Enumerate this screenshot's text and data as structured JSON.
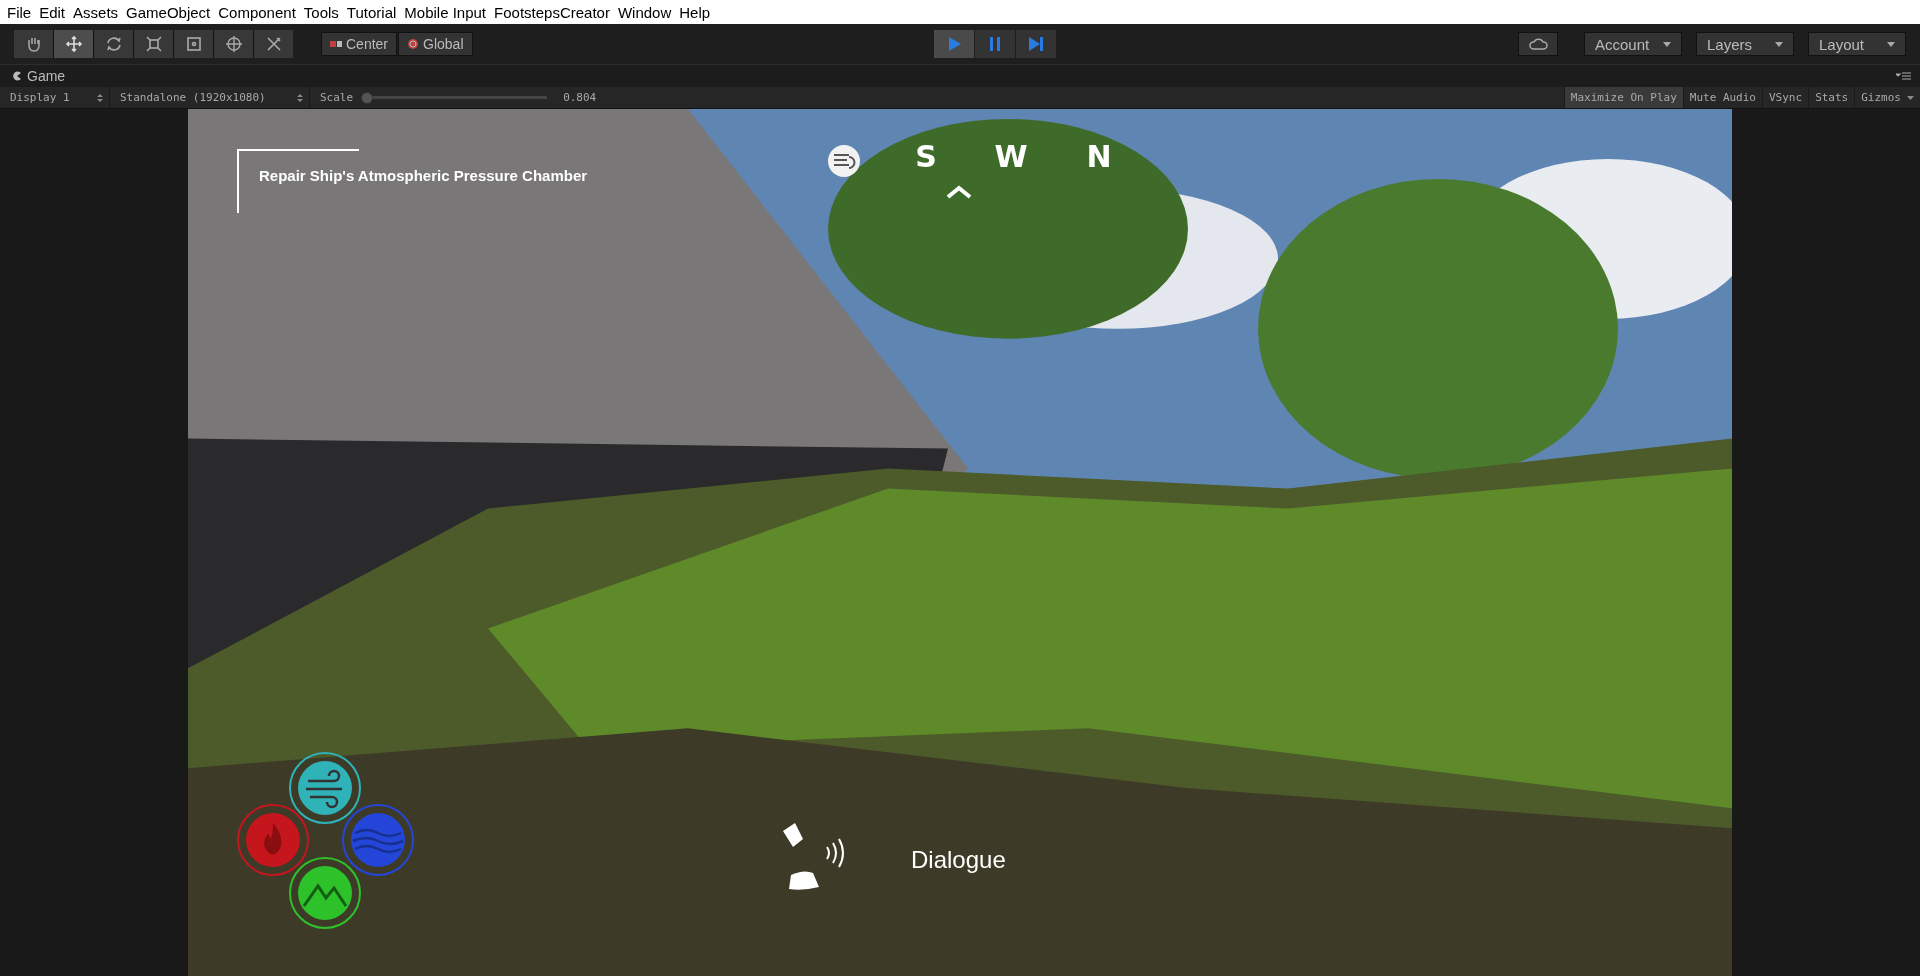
{
  "menu": [
    "File",
    "Edit",
    "Assets",
    "GameObject",
    "Component",
    "Tools",
    "Tutorial",
    "Mobile Input",
    "FootstepsCreator",
    "Window",
    "Help"
  ],
  "toolbar": {
    "tools": [
      {
        "kind": "hand",
        "selected": false
      },
      {
        "kind": "move",
        "selected": true
      },
      {
        "kind": "rotate",
        "selected": false
      },
      {
        "kind": "scale",
        "selected": false
      },
      {
        "kind": "rect",
        "selected": false
      },
      {
        "kind": "transform",
        "selected": false
      },
      {
        "kind": "custom",
        "selected": false
      }
    ],
    "pivot": [
      "Center",
      "Global"
    ],
    "playback": [
      {
        "kind": "play",
        "selected": true
      },
      {
        "kind": "pause",
        "selected": false
      },
      {
        "kind": "step",
        "selected": false
      }
    ],
    "dropdowns": [
      "Account",
      "Layers",
      "Layout"
    ]
  },
  "game_tab": {
    "title": "Game"
  },
  "game_bar": {
    "display": "Display 1",
    "resolution": "Standalone (1920x1080)",
    "scale": {
      "label": "Scale",
      "level": 0,
      "reading": "0.804"
    },
    "toggles": [
      {
        "label": "Maximize On Play",
        "on": true
      },
      {
        "label": "Mute Audio",
        "on": false
      },
      {
        "label": "VSync",
        "on": false
      },
      {
        "label": "Stats",
        "on": false
      }
    ],
    "gizmos": "Gizmos"
  },
  "hud": {
    "objective": "Repair Ship's Atmospheric Pressure Chamber",
    "compass": [
      "S",
      "W",
      "N"
    ],
    "elements": [
      {
        "kind": "wind",
        "color": "#2fb3b8"
      },
      {
        "kind": "fire",
        "color": "#c4161c"
      },
      {
        "kind": "water",
        "color": "#2446d8"
      },
      {
        "kind": "earth",
        "color": "#2ec22a"
      }
    ],
    "prompt": "Dialogue"
  }
}
